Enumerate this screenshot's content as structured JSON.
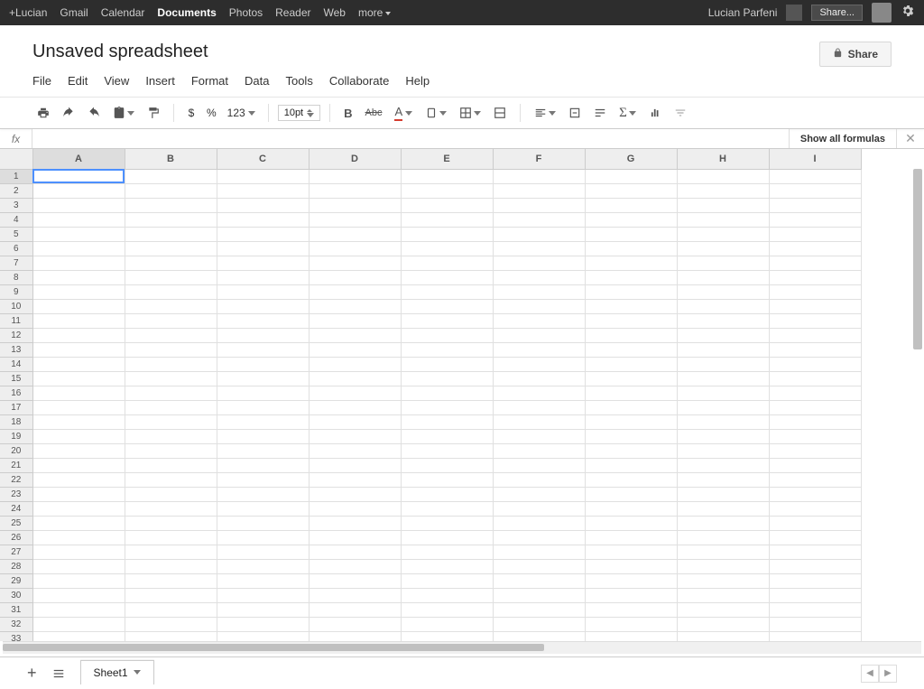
{
  "topbar": {
    "links": [
      "+Lucian",
      "Gmail",
      "Calendar",
      "Documents",
      "Photos",
      "Reader",
      "Web",
      "more"
    ],
    "active_index": 3,
    "username": "Lucian Parfeni",
    "share_label": "Share..."
  },
  "doc": {
    "title": "Unsaved spreadsheet"
  },
  "menu": [
    "File",
    "Edit",
    "View",
    "Insert",
    "Format",
    "Data",
    "Tools",
    "Collaborate",
    "Help"
  ],
  "toolbar": {
    "currency": "$",
    "percent": "%",
    "numfmt": "123",
    "font_size": "10pt",
    "bold": "B",
    "strike": "Abc",
    "textcolor_glyph": "A"
  },
  "formula_bar": {
    "fx_label": "fx",
    "show_all": "Show all formulas"
  },
  "share_button": "Share",
  "grid": {
    "columns": [
      "A",
      "B",
      "C",
      "D",
      "E",
      "F",
      "G",
      "H",
      "I"
    ],
    "rows": 36,
    "active_cell": "A1"
  },
  "tabs": {
    "sheet_name": "Sheet1"
  }
}
